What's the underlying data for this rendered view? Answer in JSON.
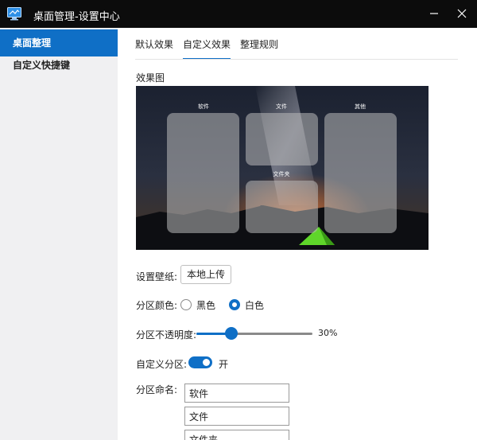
{
  "window": {
    "title": "桌面管理-设置中心"
  },
  "sidebar": {
    "items": [
      {
        "label": "桌面整理",
        "active": true
      },
      {
        "label": "自定义快捷键",
        "active": false
      }
    ]
  },
  "tabs": [
    {
      "label": "默认效果",
      "active": false
    },
    {
      "label": "自定义效果",
      "active": true
    },
    {
      "label": "整理规则",
      "active": false
    }
  ],
  "preview": {
    "label": "效果图",
    "zones": [
      {
        "title": "软件"
      },
      {
        "title": "文件"
      },
      {
        "title": "其他"
      },
      {
        "title": "文件夹"
      }
    ]
  },
  "settings": {
    "wallpaper_label": "设置壁纸:",
    "upload_button": "本地上传",
    "color_label": "分区颜色:",
    "color_options": [
      {
        "label": "黑色",
        "checked": false
      },
      {
        "label": "白色",
        "checked": true
      }
    ],
    "opacity_label": "分区不透明度:",
    "opacity_value": "30%",
    "opacity_fraction": 0.3,
    "custom_zone_label": "自定义分区:",
    "custom_zone_state": "开",
    "naming_label": "分区命名:",
    "zone_names": [
      "软件",
      "文件",
      "文件夹"
    ]
  },
  "colors": {
    "accent": "#0f6fc6",
    "titlebar": "#0c0c0c",
    "sidebar_bg": "#f0f0f2"
  }
}
